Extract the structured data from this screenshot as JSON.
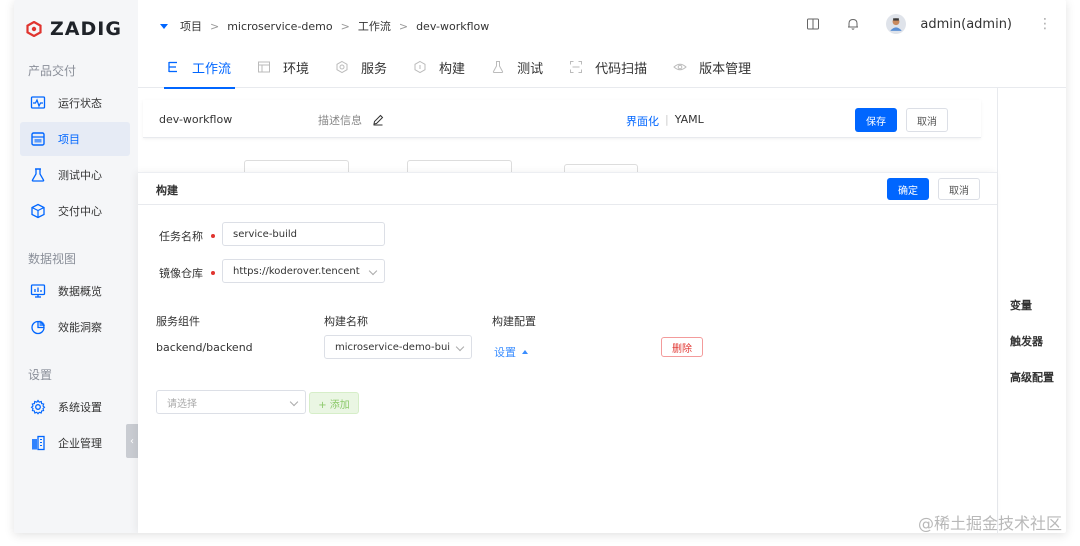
{
  "brand": {
    "name": "ZADIG",
    "accent": "#0066ff",
    "logo_color": "#e0342f"
  },
  "sidebar": {
    "sections": [
      {
        "title": "产品交付"
      },
      {
        "title": "数据视图"
      },
      {
        "title": "设置"
      }
    ],
    "items": [
      {
        "label": "运行状态",
        "icon": "monitor-pulse-icon"
      },
      {
        "label": "项目",
        "icon": "project-board-icon",
        "active": true
      },
      {
        "label": "测试中心",
        "icon": "flask-icon"
      },
      {
        "label": "交付中心",
        "icon": "package-cube-icon"
      },
      {
        "label": "数据概览",
        "icon": "dashboard-screen-icon"
      },
      {
        "label": "效能洞察",
        "icon": "pie-chart-icon"
      },
      {
        "label": "系统设置",
        "icon": "gear-icon"
      },
      {
        "label": "企业管理",
        "icon": "building-icon"
      }
    ]
  },
  "breadcrumb": [
    "项目",
    "microservice-demo",
    "工作流",
    "dev-workflow"
  ],
  "breadcrumb_sep": ">",
  "user": {
    "name": "admin(admin)"
  },
  "tabs": [
    {
      "label": "工作流",
      "icon": "workflow-icon",
      "active": true
    },
    {
      "label": "环境",
      "icon": "environment-icon"
    },
    {
      "label": "服务",
      "icon": "service-icon"
    },
    {
      "label": "构建",
      "icon": "build-icon"
    },
    {
      "label": "测试",
      "icon": "test-icon"
    },
    {
      "label": "代码扫描",
      "icon": "scan-icon"
    },
    {
      "label": "版本管理",
      "icon": "version-icon"
    }
  ],
  "workflow_bar": {
    "name": "dev-workflow",
    "desc_label": "描述信息",
    "mode_visual": "界面化",
    "mode_yaml": "YAML",
    "save": "保存",
    "cancel": "取消"
  },
  "panel": {
    "title": "构建",
    "confirm": "确定",
    "cancel": "取消",
    "task_name_label": "任务名称",
    "task_name_value": "service-build",
    "registry_label": "镜像仓库",
    "registry_value": "https://koderover.tencent",
    "columns": [
      "服务组件",
      "构建名称",
      "构建配置"
    ],
    "rows": [
      {
        "service": "backend/backend",
        "build_name": "microservice-demo-bui",
        "config_link": "设置",
        "delete": "删除"
      }
    ],
    "select_placeholder": "请选择",
    "add_label": "+ 添加"
  },
  "side_menu": [
    "变量",
    "触发器",
    "高级配置"
  ],
  "watermark": "@稀土掘金技术社区"
}
